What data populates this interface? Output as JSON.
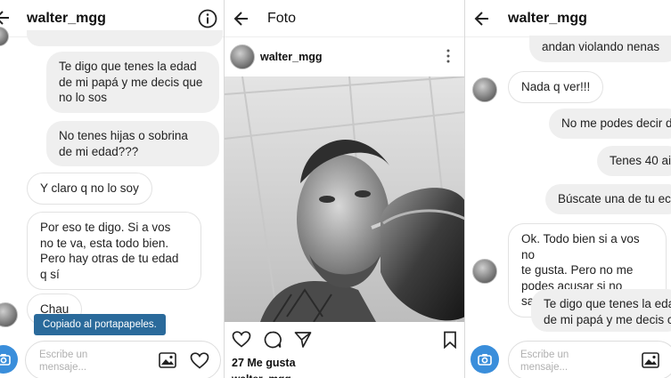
{
  "left_chat": {
    "username": "walter_mgg",
    "messages": [
      {
        "text": "Te digo que tenes la edad\nde mi papá y me decis que\nno lo sos"
      },
      {
        "text": "No tenes hijas o sobrina\nde mi edad???"
      },
      {
        "text": "Y claro q no lo soy"
      },
      {
        "text": "Por eso te digo. Si a vos\nno te va, esta todo bien.\nPero hay otras de tu edad\nq sí"
      },
      {
        "text": "Chau"
      }
    ],
    "toast": "Copiado al portapapeles.",
    "input_placeholder": "Escribe un\nmensaje..."
  },
  "photo_view": {
    "title": "Foto",
    "username": "walter_mgg",
    "likes": "27 Me gusta",
    "caption_partial": "walter_mgg"
  },
  "right_chat": {
    "username": "walter_mgg",
    "messages": [
      {
        "text": "andan violando nenas"
      },
      {
        "text": "Nada q ver!!!"
      },
      {
        "text": "No me podes decir d"
      },
      {
        "text": "Tenes 40 ai"
      },
      {
        "text": "Búscate una de tu ec"
      },
      {
        "text": "Ok. Todo bien si a vos no\nte gusta. Pero no me\npodes acusar si no sabes."
      },
      {
        "text": "Te digo que tenes la eda\nde mi papá y me decis c"
      }
    ],
    "input_placeholder": "Escribe un\nmensaje..."
  },
  "colors": {
    "accent": "#3a8edb",
    "bubble_in": "#efefef",
    "toast_bg": "#2a6a9b"
  },
  "icons": [
    "back-arrow-icon",
    "info-icon",
    "camera-icon",
    "gallery-icon",
    "heart-icon",
    "comment-icon",
    "share-icon",
    "bookmark-icon",
    "more-icon"
  ]
}
